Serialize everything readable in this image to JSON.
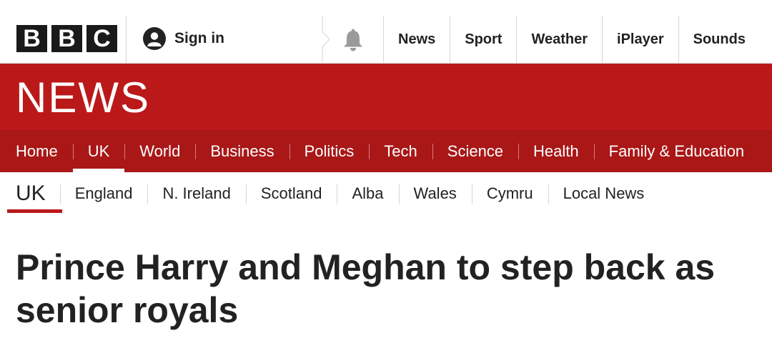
{
  "masthead": {
    "logo_letters": [
      "B",
      "B",
      "C"
    ],
    "signin_label": "Sign in",
    "signin_icon": "user-account-icon",
    "notifications_icon": "bell-icon",
    "top_nav": [
      {
        "label": "News"
      },
      {
        "label": "Sport"
      },
      {
        "label": "Weather"
      },
      {
        "label": "iPlayer"
      },
      {
        "label": "Sounds"
      }
    ]
  },
  "banner": {
    "title": "NEWS",
    "background_color": "#bb1919"
  },
  "section_nav": [
    {
      "label": "Home",
      "active": false
    },
    {
      "label": "UK",
      "active": true
    },
    {
      "label": "World",
      "active": false
    },
    {
      "label": "Business",
      "active": false
    },
    {
      "label": "Politics",
      "active": false
    },
    {
      "label": "Tech",
      "active": false
    },
    {
      "label": "Science",
      "active": false
    },
    {
      "label": "Health",
      "active": false
    },
    {
      "label": "Family & Education",
      "active": false
    }
  ],
  "sub_nav": {
    "current": "UK",
    "items": [
      {
        "label": "England"
      },
      {
        "label": "N. Ireland"
      },
      {
        "label": "Scotland"
      },
      {
        "label": "Alba"
      },
      {
        "label": "Wales"
      },
      {
        "label": "Cymru"
      },
      {
        "label": "Local News"
      }
    ]
  },
  "article": {
    "headline": "Prince Harry and Meghan to step back as senior royals"
  }
}
